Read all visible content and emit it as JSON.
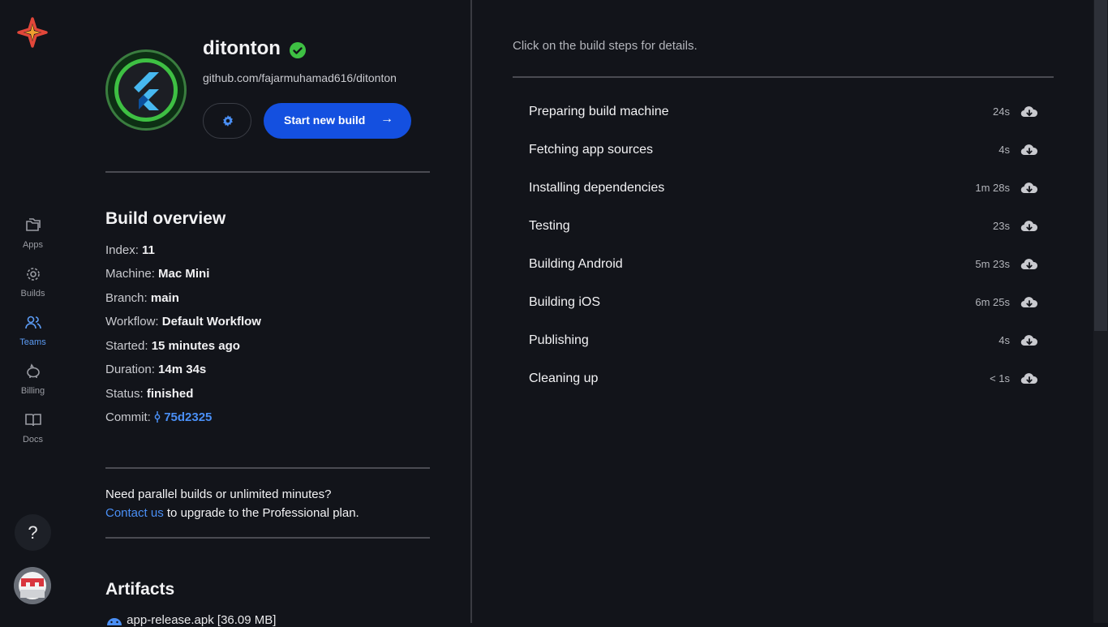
{
  "nav": {
    "items": [
      {
        "label": "Apps",
        "icon": "folders-icon"
      },
      {
        "label": "Builds",
        "icon": "builds-gear-icon"
      },
      {
        "label": "Teams",
        "icon": "team-icon"
      },
      {
        "label": "Billing",
        "icon": "piggy-bank-icon"
      },
      {
        "label": "Docs",
        "icon": "book-icon"
      }
    ],
    "help_label": "?"
  },
  "app": {
    "name": "ditonton",
    "repo": "github.com/fajarmuhamad616/ditonton",
    "start_build_label": "Start new build",
    "start_build_arrow": "→"
  },
  "overview": {
    "title": "Build overview",
    "rows": [
      {
        "label": "Index:",
        "value": "11"
      },
      {
        "label": "Machine:",
        "value": "Mac Mini"
      },
      {
        "label": "Branch:",
        "value": "main"
      },
      {
        "label": "Workflow:",
        "value": "Default Workflow"
      },
      {
        "label": "Started:",
        "value": "15 minutes ago"
      },
      {
        "label": "Duration:",
        "value": "14m 34s"
      },
      {
        "label": "Status:",
        "value": "finished"
      }
    ],
    "commit_label": "Commit:",
    "commit_value": "75d2325"
  },
  "upgrade": {
    "line1": "Need parallel builds or unlimited minutes?",
    "link": "Contact us",
    "line2_rest": " to upgrade to the Professional plan."
  },
  "artifacts": {
    "title": "Artifacts",
    "items": [
      {
        "label": "app-release.apk [36.09 MB]"
      }
    ]
  },
  "steps_panel": {
    "hint": "Click on the build steps for details.",
    "steps": [
      {
        "name": "Preparing build machine",
        "duration": "24s"
      },
      {
        "name": "Fetching app sources",
        "duration": "4s"
      },
      {
        "name": "Installing dependencies",
        "duration": "1m 28s"
      },
      {
        "name": "Testing",
        "duration": "23s"
      },
      {
        "name": "Building Android",
        "duration": "5m 23s"
      },
      {
        "name": "Building iOS",
        "duration": "6m 25s"
      },
      {
        "name": "Publishing",
        "duration": "4s"
      },
      {
        "name": "Cleaning up",
        "duration": "< 1s"
      }
    ]
  },
  "colors": {
    "accent": "#1450e0",
    "link": "#4a8ff5",
    "success": "#3ec043",
    "background": "#12141a"
  }
}
